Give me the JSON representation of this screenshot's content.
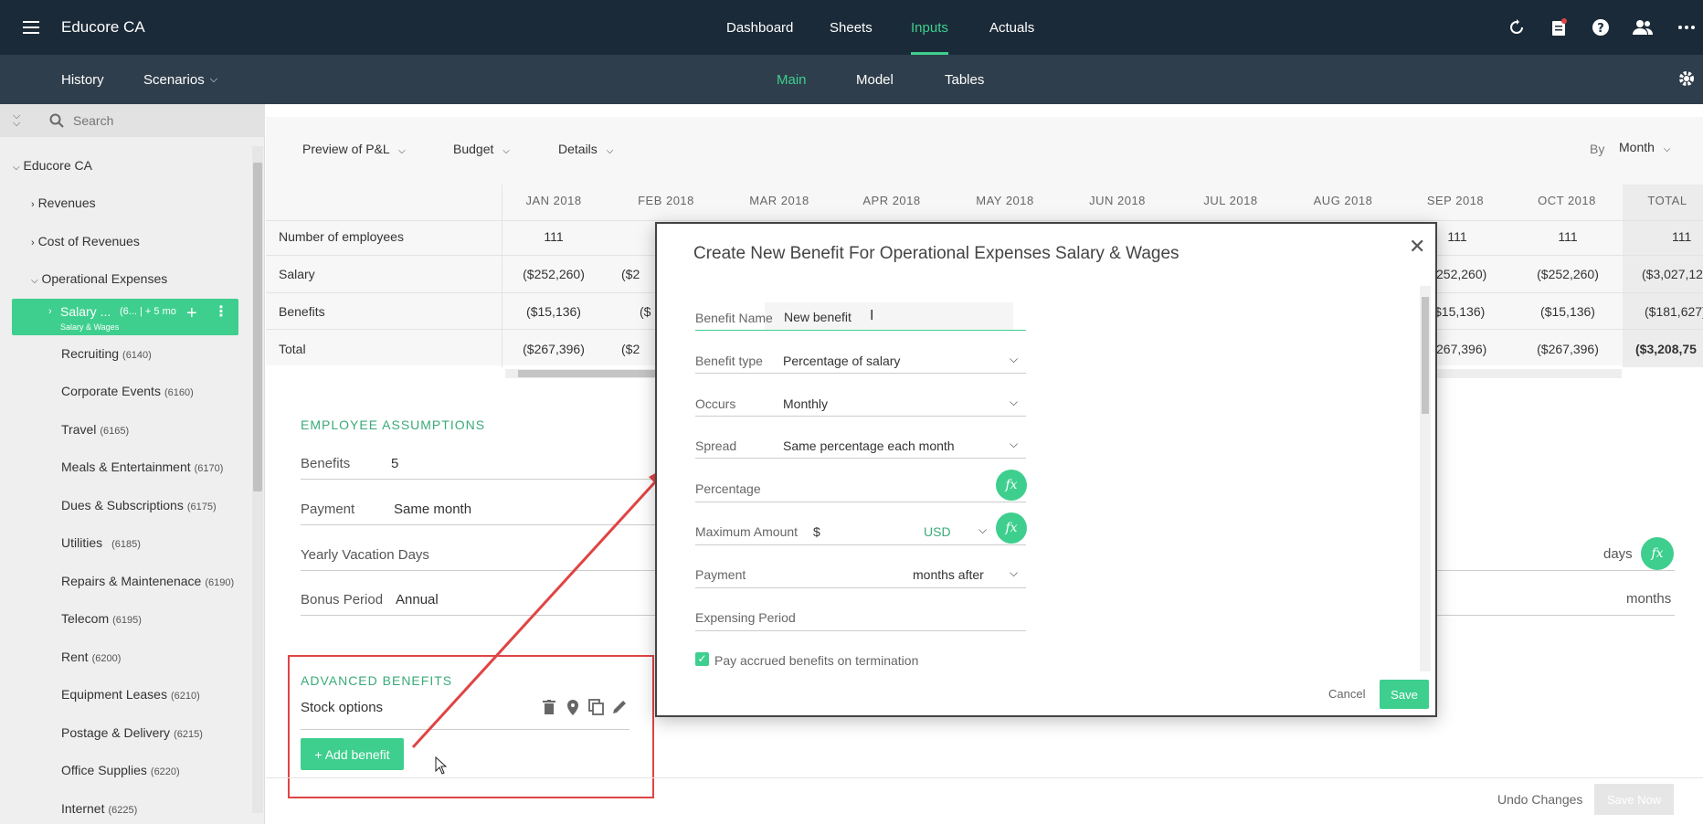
{
  "app": {
    "title": "Educore CA"
  },
  "topnav": {
    "dashboard": "Dashboard",
    "sheets": "Sheets",
    "inputs": "Inputs",
    "actuals": "Actuals"
  },
  "subnav": {
    "history": "History",
    "scenarios": "Scenarios",
    "main": "Main",
    "model": "Model",
    "tables": "Tables"
  },
  "sidebar": {
    "search_placeholder": "Search",
    "root": "Educore CA",
    "revenues": "Revenues",
    "cost_of_revenues": "Cost of Revenues",
    "operational_expenses": "Operational Expenses",
    "selected": {
      "label": "Salary ...",
      "count": "(6... | + 5 mo",
      "sub": "Salary & Wages"
    },
    "items": [
      {
        "label": "Recruiting",
        "code": "(6140)"
      },
      {
        "label": "Corporate Events",
        "code": "(6160)"
      },
      {
        "label": "Travel",
        "code": "(6165)"
      },
      {
        "label": "Meals & Entertainment",
        "code": "(6170)"
      },
      {
        "label": "Dues & Subscriptions",
        "code": "(6175)"
      },
      {
        "label": "Utilities",
        "code": "(6185)"
      },
      {
        "label": "Repairs & Maintenenace",
        "code": "(6190)"
      },
      {
        "label": "Telecom",
        "code": "(6195)"
      },
      {
        "label": "Rent",
        "code": "(6200)"
      },
      {
        "label": "Equipment Leases",
        "code": "(6210)"
      },
      {
        "label": "Postage & Delivery",
        "code": "(6215)"
      },
      {
        "label": "Office Supplies",
        "code": "(6220)"
      },
      {
        "label": "Internet",
        "code": "(6225)"
      }
    ]
  },
  "toolbar": {
    "preview": "Preview of P&L",
    "budget": "Budget",
    "details": "Details",
    "by": "By",
    "period": "Month"
  },
  "table": {
    "columns": [
      "JAN 2018",
      "FEB 2018",
      "MAR 2018",
      "APR 2018",
      "MAY 2018",
      "JUN 2018",
      "JUL 2018",
      "AUG 2018",
      "SEP 2018",
      "OCT 2018",
      "TOTAL"
    ],
    "rows": [
      {
        "label": "Number of employees",
        "jan": "111",
        "feb": "",
        "sep": "111",
        "oct": "111",
        "total": "111"
      },
      {
        "label": "Salary",
        "jan": "($252,260)",
        "feb": "($2",
        "sep": "252,260)",
        "oct": "($252,260)",
        "total": "($3,027,125"
      },
      {
        "label": "Benefits",
        "jan": "($15,136)",
        "feb": "($",
        "sep": "$15,136)",
        "oct": "($15,136)",
        "total": "($181,627)"
      },
      {
        "label": "Total",
        "jan": "($267,396)",
        "feb": "($2",
        "sep": "267,396)",
        "oct": "($267,396)",
        "total": "($3,208,75"
      }
    ]
  },
  "employee_assumptions": {
    "title": "EMPLOYEE ASSUMPTIONS",
    "benefits_label": "Benefits",
    "benefits_value": "5",
    "payment_label": "Payment",
    "payment_value": "Same month",
    "vacation_label": "Yearly Vacation Days",
    "vacation_unit": "days",
    "bonus_label": "Bonus Period",
    "bonus_value": "Annual",
    "bonus_unit": "months"
  },
  "advanced_benefits": {
    "title": "ADVANCED BENEFITS",
    "item": "Stock options",
    "add_button": "+ Add benefit"
  },
  "modal": {
    "title": "Create New Benefit For Operational Expenses Salary & Wages",
    "benefit_name_label": "Benefit Name",
    "benefit_name_value": "New benefit",
    "benefit_type_label": "Benefit type",
    "benefit_type_value": "Percentage of salary",
    "occurs_label": "Occurs",
    "occurs_value": "Monthly",
    "spread_label": "Spread",
    "spread_value": "Same percentage each month",
    "percentage_label": "Percentage",
    "max_amount_label": "Maximum Amount",
    "currency_symbol": "$",
    "currency": "USD",
    "payment_label": "Payment",
    "payment_value": "months after",
    "expensing_label": "Expensing Period",
    "termination_label": "Pay accrued benefits on termination",
    "termination_checked": true,
    "cancel": "Cancel",
    "save": "Save"
  },
  "footer": {
    "undo": "Undo Changes",
    "save_now": "Save Now"
  },
  "colors": {
    "accent": "#3ecf8e",
    "topbar": "#1b2a38",
    "subbar": "#2f3e4c",
    "annotation": "#e04444"
  }
}
